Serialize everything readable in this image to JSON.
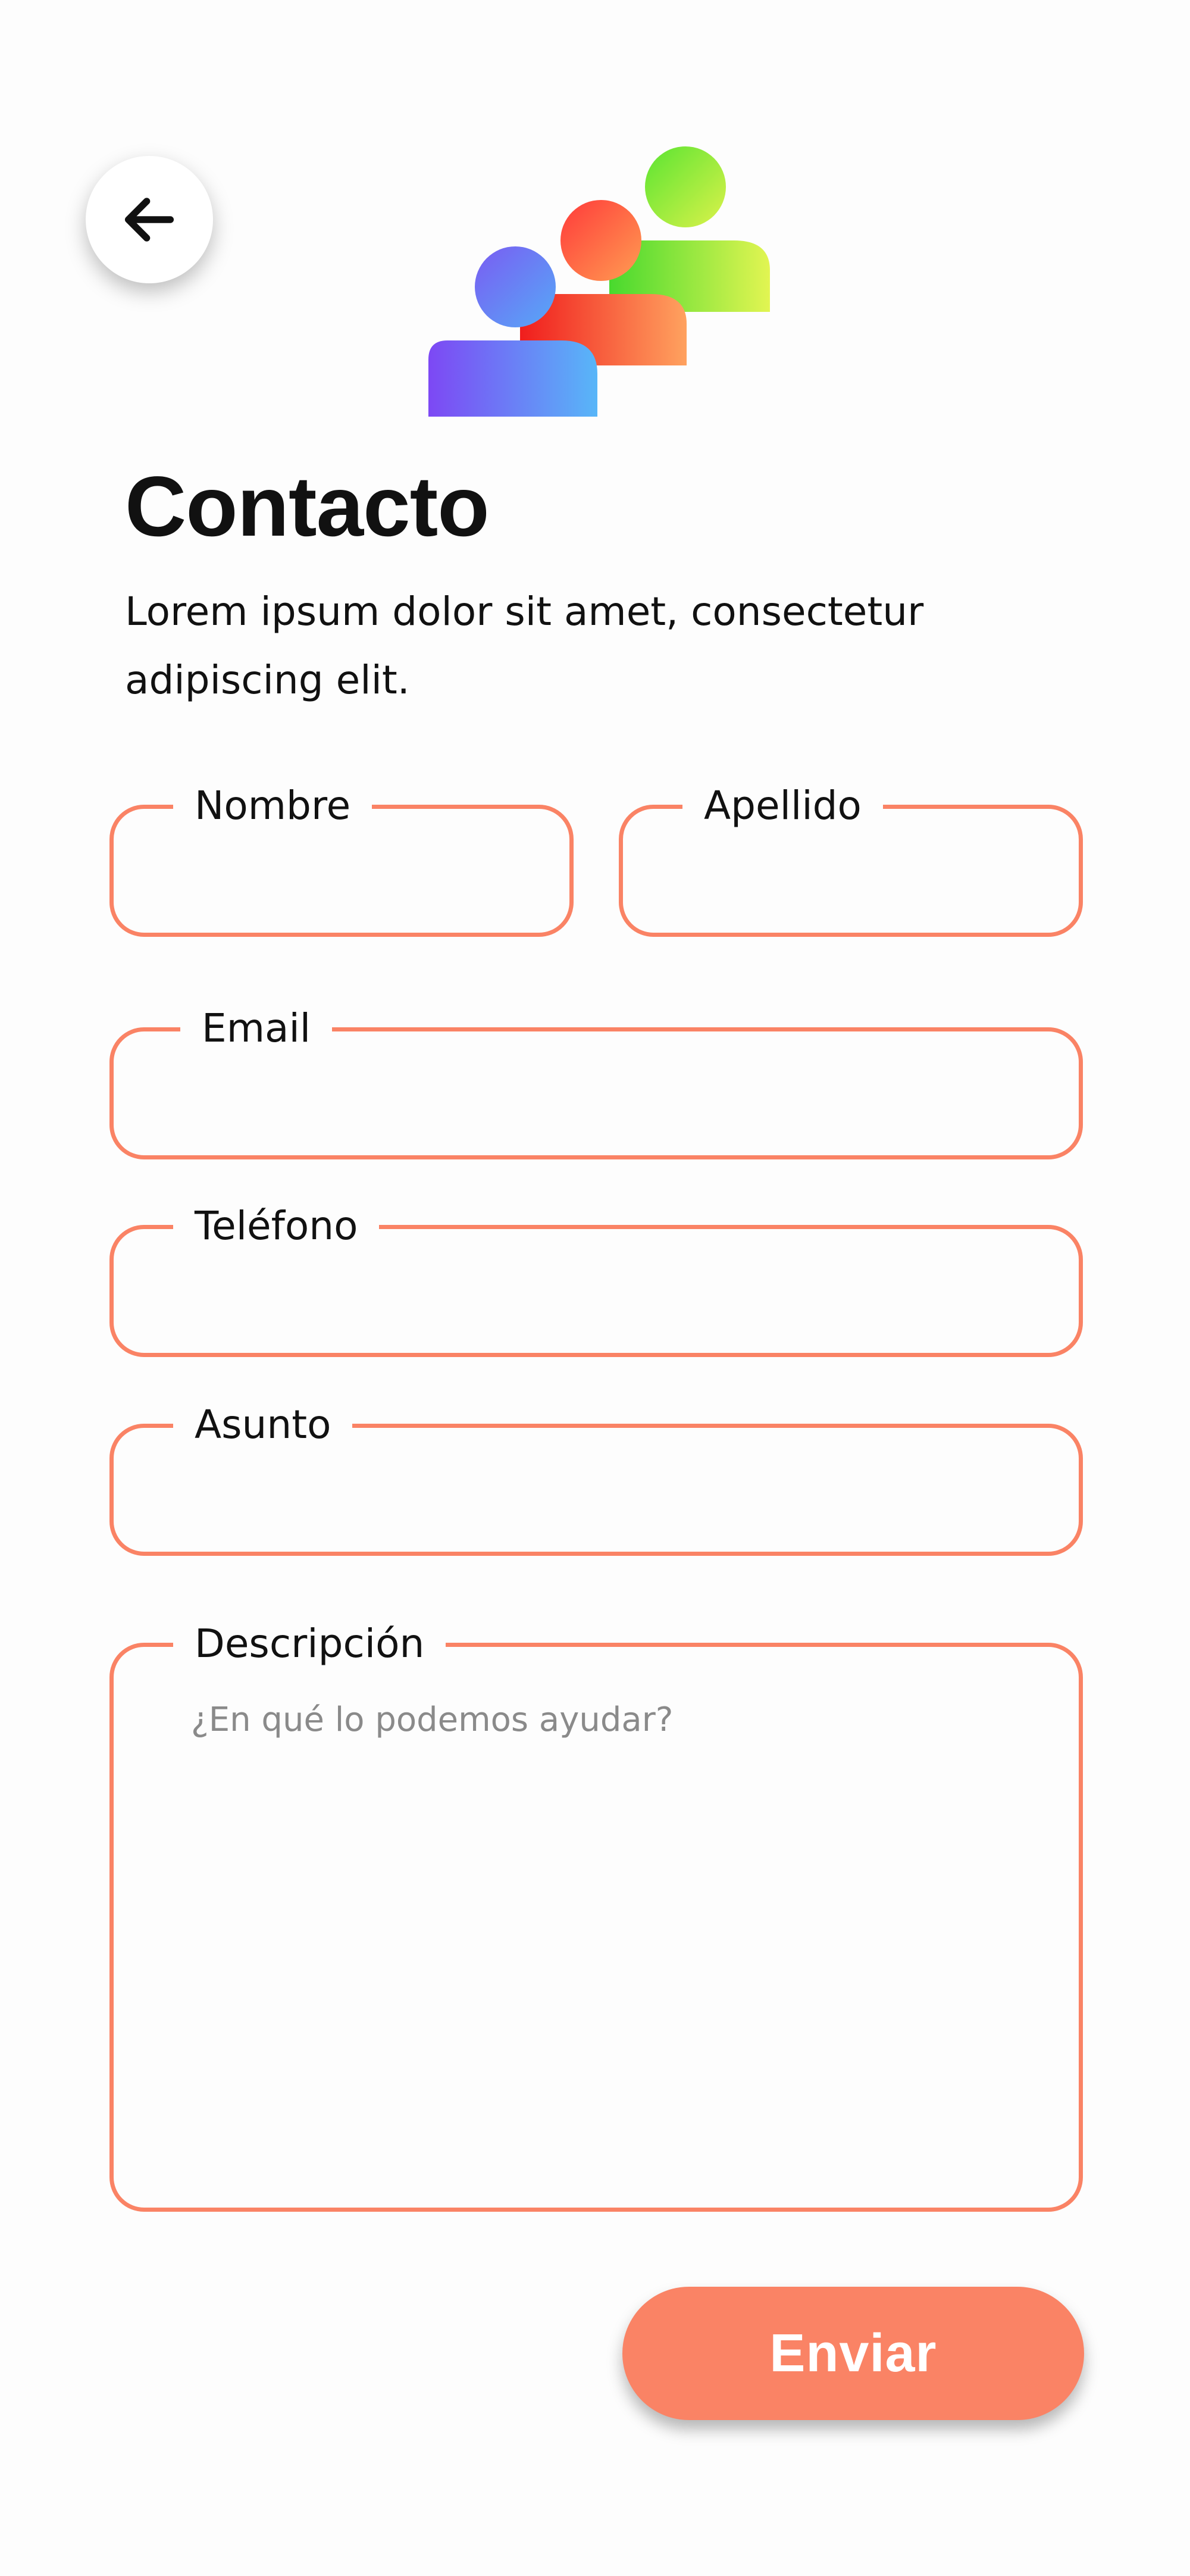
{
  "header": {
    "back_icon": "arrow-left-icon",
    "illustration": "people-group-icon"
  },
  "contact": {
    "title": "Contacto",
    "subtitle": "Lorem ipsum dolor sit amet, consectetur adipiscing elit."
  },
  "form": {
    "nombre_label": "Nombre",
    "apellido_label": "Apellido",
    "email_label": "Email",
    "telefono_label": "Teléfono",
    "asunto_label": "Asunto",
    "descripcion_label": "Descripción",
    "descripcion_placeholder": "¿En qué lo podemos ayudar?",
    "submit_label": "Enviar"
  },
  "colors": {
    "accent": "#fa8365",
    "background": "#fdfdfd",
    "text": "#111111"
  }
}
